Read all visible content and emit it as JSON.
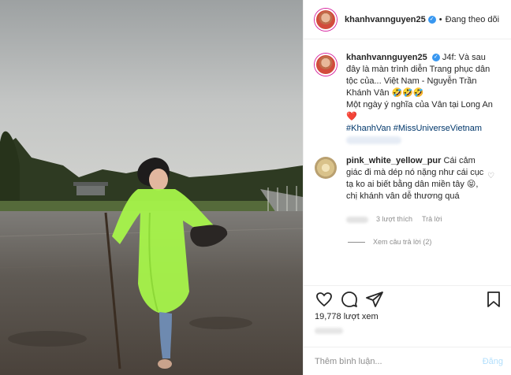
{
  "post": {
    "username": "khanhvannguyen25",
    "verified_icon": "verified-badge-icon",
    "separator": "•",
    "follow_status": "Đang theo dõi",
    "caption_line1": "J4f: Và sau đây là màn trình diễn Trang phục dân tộc của... Việt Nam - Nguyễn Trần Khánh Vân 🤣🤣🤣",
    "caption_line2": "Một ngày ý nghĩa của Vân tại Long An ❤️",
    "caption_tags": "#KhanhVan #MissUniverseVietnam"
  },
  "comment": {
    "username": "pink_white_yellow_pur",
    "text": "Cái cảm giác đi mà dép nó nặng như cái cục tạ ko ai biết bằng dân miền tây 😝, chị khánh vân dễ thương quá",
    "likes": "3 lượt thích",
    "reply": "Trả lời",
    "view_replies": "Xem câu trả lời (2)"
  },
  "stats": {
    "views": "19,778 lượt xem"
  },
  "add_comment": {
    "placeholder": "Thêm bình luận...",
    "post_label": "Đăng"
  },
  "colors": {
    "link": "#00376b",
    "verified": "#3897f0",
    "post_disabled": "#b2dffc",
    "raincoat": "#a7f44a"
  }
}
